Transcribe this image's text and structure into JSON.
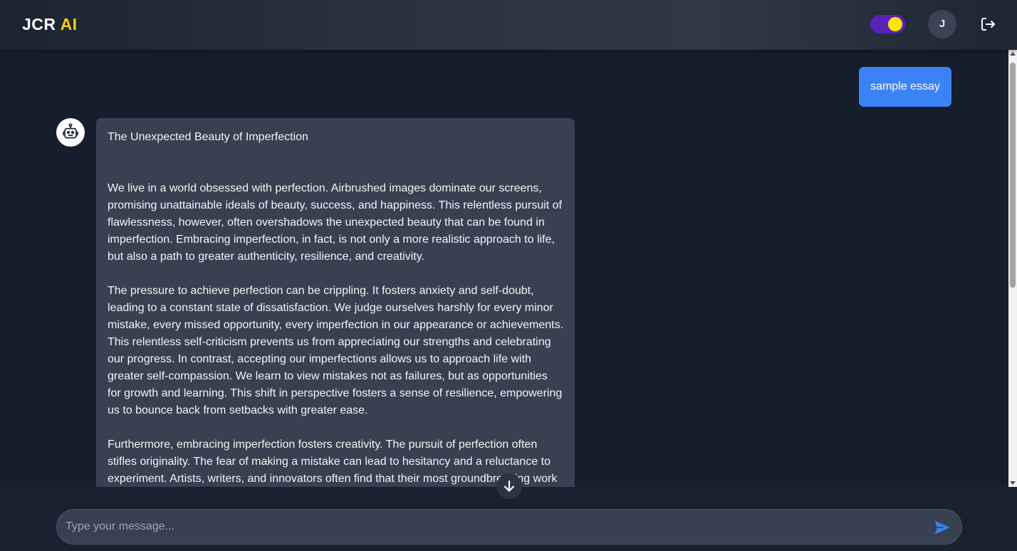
{
  "header": {
    "logo_main": "JCR ",
    "logo_accent": "AI",
    "user_initial": "J"
  },
  "icons": {
    "theme_toggle": "sun-toggle-icon",
    "logout": "logout-icon",
    "bot": "robot-icon",
    "scroll_down": "arrow-down-icon",
    "send": "send-icon"
  },
  "colors": {
    "accent": "#3b82f6",
    "logo_accent": "#facc15",
    "toggle_track": "#5b21b6",
    "toggle_knob": "#fde400"
  },
  "messages": {
    "user": "sample essay",
    "bot": {
      "title": "The Unexpected Beauty of Imperfection",
      "paragraphs": [
        "We live in a world obsessed with perfection. Airbrushed images dominate our screens, promising unattainable ideals of beauty, success, and happiness. This relentless pursuit of flawlessness, however, often overshadows the unexpected beauty that can be found in imperfection. Embracing imperfection, in fact, is not only a more realistic approach to life, but also a path to greater authenticity, resilience, and creativity.",
        "The pressure to achieve perfection can be crippling. It fosters anxiety and self-doubt, leading to a constant state of dissatisfaction. We judge ourselves harshly for every minor mistake, every missed opportunity, every imperfection in our appearance or achievements. This relentless self-criticism prevents us from appreciating our strengths and celebrating our progress. In contrast, accepting our imperfections allows us to approach life with greater self-compassion. We learn to view mistakes not as failures, but as opportunities for growth and learning. This shift in perspective fosters a sense of resilience, empowering us to bounce back from setbacks with greater ease.",
        "Furthermore, embracing imperfection fosters creativity. The pursuit of perfection often stifles originality. The fear of making a mistake can lead to hesitancy and a reluctance to experiment. Artists, writers, and innovators often find that their most groundbreaking work"
      ]
    }
  },
  "composer": {
    "placeholder": "Type your message..."
  }
}
